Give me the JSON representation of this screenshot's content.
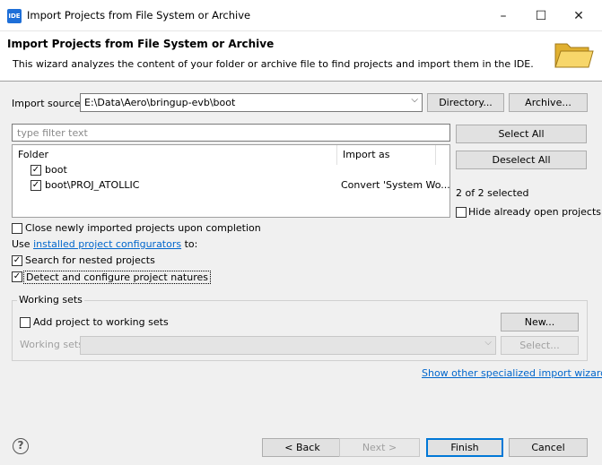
{
  "window": {
    "app_icon": "IDE",
    "title": "Import Projects from File System or Archive",
    "minimize": "–",
    "maximize": "☐",
    "close": "✕"
  },
  "banner": {
    "title": "Import Projects from File System or Archive",
    "description": "This wizard analyzes the content of your folder or archive file to find projects and import them in the IDE."
  },
  "source": {
    "label": "Import source:",
    "value": "E:\\Data\\Aero\\bringup-evb\\boot",
    "directory_label": "Directory...",
    "archive_label": "Archive..."
  },
  "filter": {
    "placeholder": "type filter text"
  },
  "table": {
    "columns": [
      "Folder",
      "Import as"
    ],
    "rows": [
      {
        "folder": "boot",
        "import_as": "",
        "checked": true
      },
      {
        "folder": "boot\\PROJ_ATOLLIC",
        "import_as": "Convert 'System Wo...",
        "checked": true
      }
    ]
  },
  "side": {
    "select_all": "Select All",
    "deselect_all": "Deselect All",
    "selected_count": "2 of 2 selected",
    "hide_open": "Hide already open projects"
  },
  "options": {
    "close_imported": "Close newly imported projects upon completion",
    "use_prefix": "Use",
    "configurators_link": "installed project configurators",
    "use_suffix": "to:",
    "search_nested": "Search for nested projects",
    "detect_natures": "Detect and configure project natures"
  },
  "working_sets": {
    "group_label": "Working sets",
    "add_label": "Add project to working sets",
    "new_label": "New...",
    "sets_label": "Working sets:",
    "select_label": "Select..."
  },
  "footer": {
    "show_other_link": "Show other specialized import wizards",
    "help": "?",
    "back": "< Back",
    "next": "Next >",
    "finish": "Finish",
    "cancel": "Cancel"
  },
  "colors": {
    "accent": "#0078d7",
    "link": "#0066cc",
    "folder_yellow": "#f2c94c"
  }
}
